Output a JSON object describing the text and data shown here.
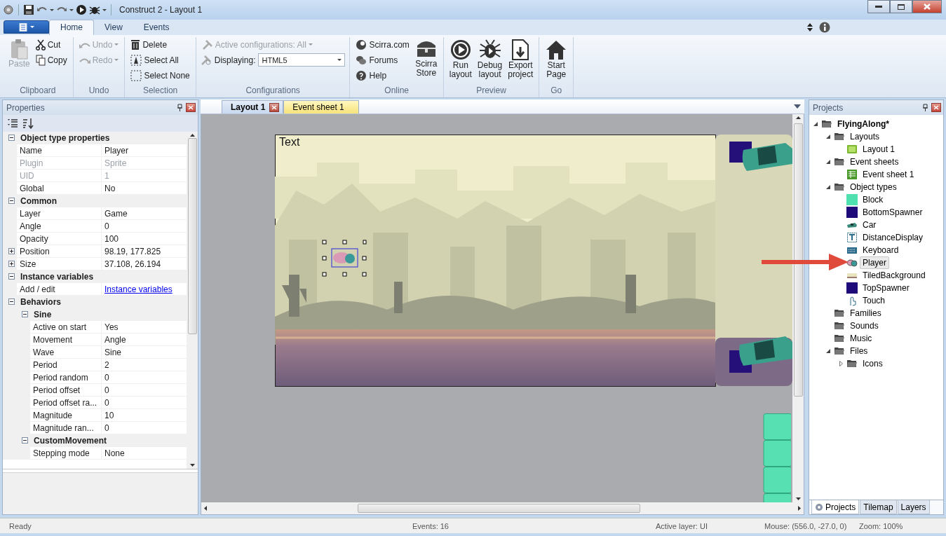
{
  "window": {
    "title": "Construct 2 - Layout 1"
  },
  "ribbon_tabs": [
    {
      "label": "Home",
      "selected": true
    },
    {
      "label": "View",
      "selected": false
    },
    {
      "label": "Events",
      "selected": false
    }
  ],
  "ribbon_groups": [
    {
      "label": "Clipboard",
      "items": [
        {
          "label": "Paste",
          "kind": "large",
          "disabled": true
        },
        {
          "label": "Cut",
          "kind": "small",
          "disabled": false
        },
        {
          "label": "Copy",
          "kind": "small",
          "disabled": false
        }
      ]
    },
    {
      "label": "Undo",
      "items": [
        {
          "label": "Undo",
          "kind": "small",
          "disabled": true,
          "dropdown": true
        },
        {
          "label": "Redo",
          "kind": "small",
          "disabled": true,
          "dropdown": true
        }
      ]
    },
    {
      "label": "Selection",
      "items": [
        {
          "label": "Delete",
          "kind": "small",
          "disabled": false
        },
        {
          "label": "Select All",
          "kind": "small",
          "disabled": false
        },
        {
          "label": "Select None",
          "kind": "small",
          "disabled": false
        }
      ]
    },
    {
      "label": "Configurations",
      "items": [
        {
          "label": "Active configurations: All",
          "kind": "small",
          "disabled": true,
          "dropdown": true
        },
        {
          "label": "Displaying:",
          "kind": "select",
          "disabled": false,
          "value": "HTML5"
        }
      ]
    },
    {
      "label": "Online",
      "items": [
        {
          "label": "Scirra.com",
          "kind": "small",
          "disabled": false
        },
        {
          "label": "Forums",
          "kind": "small",
          "disabled": false
        },
        {
          "label": "Help",
          "kind": "small",
          "disabled": false
        },
        {
          "label": "Scirra Store",
          "kind": "large",
          "disabled": false
        }
      ]
    },
    {
      "label": "Preview",
      "items": [
        {
          "label": "Run layout",
          "kind": "large",
          "disabled": false
        },
        {
          "label": "Debug layout",
          "kind": "large",
          "disabled": false
        },
        {
          "label": "Export project",
          "kind": "large",
          "disabled": false
        }
      ]
    },
    {
      "label": "Go",
      "items": [
        {
          "label": "Start Page",
          "kind": "large",
          "disabled": false
        }
      ]
    }
  ],
  "properties": {
    "title": "Properties",
    "sections": [
      {
        "title": "Object type properties",
        "expanded": true,
        "rows": [
          {
            "name": "Name",
            "value": "Player"
          },
          {
            "name": "Plugin",
            "value": "Sprite",
            "disabled": true
          },
          {
            "name": "UID",
            "value": "1",
            "disabled": true
          },
          {
            "name": "Global",
            "value": "No"
          }
        ]
      },
      {
        "title": "Common",
        "expanded": true,
        "rows": [
          {
            "name": "Layer",
            "value": "Game"
          },
          {
            "name": "Angle",
            "value": "0"
          },
          {
            "name": "Opacity",
            "value": "100"
          },
          {
            "name": "Position",
            "value": "98.19, 177.825",
            "expanded": false
          },
          {
            "name": "Size",
            "value": "37.108, 26.194",
            "expanded": false
          }
        ]
      },
      {
        "title": "Instance variables",
        "expanded": true,
        "rows": [
          {
            "name": "Add / edit",
            "value": "Instance variables",
            "kind": "link"
          }
        ]
      },
      {
        "title": "Behaviors",
        "expanded": true,
        "children": [
          {
            "title": "Sine",
            "expanded": true,
            "rows": [
              {
                "name": "Active on start",
                "value": "Yes"
              },
              {
                "name": "Movement",
                "value": "Angle"
              },
              {
                "name": "Wave",
                "value": "Sine"
              },
              {
                "name": "Period",
                "value": "2"
              },
              {
                "name": "Period random",
                "value": "0"
              },
              {
                "name": "Period offset",
                "value": "0"
              },
              {
                "name": "Period offset ra...",
                "value": "0"
              },
              {
                "name": "Magnitude",
                "value": "10"
              },
              {
                "name": "Magnitude ran...",
                "value": "0"
              }
            ]
          },
          {
            "title": "CustomMovement",
            "expanded": true,
            "rows": [
              {
                "name": "Stepping mode",
                "value": "None"
              }
            ]
          }
        ]
      }
    ]
  },
  "editor_tabs": [
    {
      "label": "Layout 1",
      "selected": true,
      "closable": true
    },
    {
      "label": "Event sheet 1",
      "selected": false,
      "closable": false
    }
  ],
  "layout_view": {
    "text_object": "Text"
  },
  "projects": {
    "title": "Projects",
    "tree": [
      {
        "label": "FlyingAlong*",
        "kind": "folder",
        "expanded": true,
        "selected": false,
        "children": [
          {
            "label": "Layouts",
            "kind": "folder",
            "expanded": true,
            "selected": false,
            "children": [
              {
                "label": "Layout 1",
                "kind": "layout",
                "selected": false
              }
            ]
          },
          {
            "label": "Event sheets",
            "kind": "folder",
            "expanded": true,
            "selected": false,
            "children": [
              {
                "label": "Event sheet 1",
                "kind": "eventsheet",
                "selected": false
              }
            ]
          },
          {
            "label": "Object types",
            "kind": "folder",
            "expanded": true,
            "selected": false,
            "children": [
              {
                "label": "Block",
                "kind": "swatch",
                "color": "#4fe0b0",
                "selected": false
              },
              {
                "label": "BottomSpawner",
                "kind": "swatch",
                "color": "#1e0a78",
                "selected": false
              },
              {
                "label": "Car",
                "kind": "car",
                "selected": false
              },
              {
                "label": "DistanceDisplay",
                "kind": "text",
                "selected": false
              },
              {
                "label": "Keyboard",
                "kind": "keyboard",
                "selected": false
              },
              {
                "label": "Player",
                "kind": "player",
                "selected": true
              },
              {
                "label": "TiledBackground",
                "kind": "tiled",
                "selected": false
              },
              {
                "label": "TopSpawner",
                "kind": "swatch",
                "color": "#1e0a78",
                "selected": false
              },
              {
                "label": "Touch",
                "kind": "touch",
                "selected": false
              }
            ]
          },
          {
            "label": "Families",
            "kind": "folder",
            "selected": false
          },
          {
            "label": "Sounds",
            "kind": "folder",
            "selected": false
          },
          {
            "label": "Music",
            "kind": "folder",
            "selected": false
          },
          {
            "label": "Files",
            "kind": "folder",
            "expanded": true,
            "selected": false,
            "children": [
              {
                "label": "Icons",
                "kind": "folder",
                "expanded": false,
                "selected": false
              }
            ]
          }
        ]
      }
    ],
    "bottom_tabs": [
      {
        "label": "Projects",
        "selected": true
      },
      {
        "label": "Tilemap",
        "selected": false
      },
      {
        "label": "Layers",
        "selected": false
      }
    ]
  },
  "status_bar": {
    "state": "Ready",
    "events": "Events: 16",
    "active_layer": "Active layer: UI",
    "mouse": "Mouse: (556.0, -27.0, 0)",
    "zoom": "Zoom: 100%"
  }
}
